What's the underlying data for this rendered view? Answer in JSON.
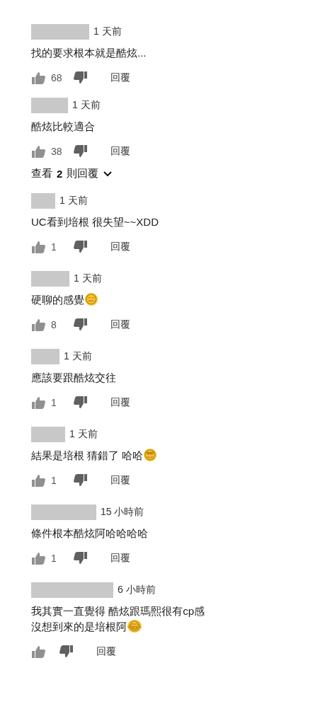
{
  "comments": [
    {
      "time": "1 天前",
      "text": "找的要求根本就是酷炫...",
      "likes": "68",
      "reply": "回覆"
    },
    {
      "time": "1 天前",
      "text": "酷炫比較適合",
      "likes": "38",
      "reply": "回覆"
    }
  ],
  "view_replies": {
    "prefix": "查看",
    "count": "2",
    "suffix": "則回覆",
    "expanded": false
  },
  "replies": [
    {
      "time": "1 天前",
      "text": "UC看到培根 很失望~~XDD",
      "likes": "1",
      "reply": "回覆"
    },
    {
      "time": "1 天前",
      "text": "硬聊的感覺",
      "emoji": "😑",
      "likes": "8",
      "reply": "回覆"
    },
    {
      "time": "1 天前",
      "text": "應該要跟酷炫交往",
      "likes": "1",
      "reply": "回覆"
    },
    {
      "time": "1 天前",
      "text": "結果是培根 猜錯了 哈哈",
      "emoji": "😎",
      "likes": "1",
      "reply": "回覆"
    },
    {
      "time": "15 小時前",
      "text": "條件根本酷炫阿哈哈哈哈",
      "likes": "1",
      "reply": "回覆"
    },
    {
      "time": "6 小時前",
      "text": "我其實一直覺得 酷炫跟瑪熙很有cp感沒想到來的是培根阿",
      "emoji": "😂",
      "reply": "回覆"
    }
  ]
}
